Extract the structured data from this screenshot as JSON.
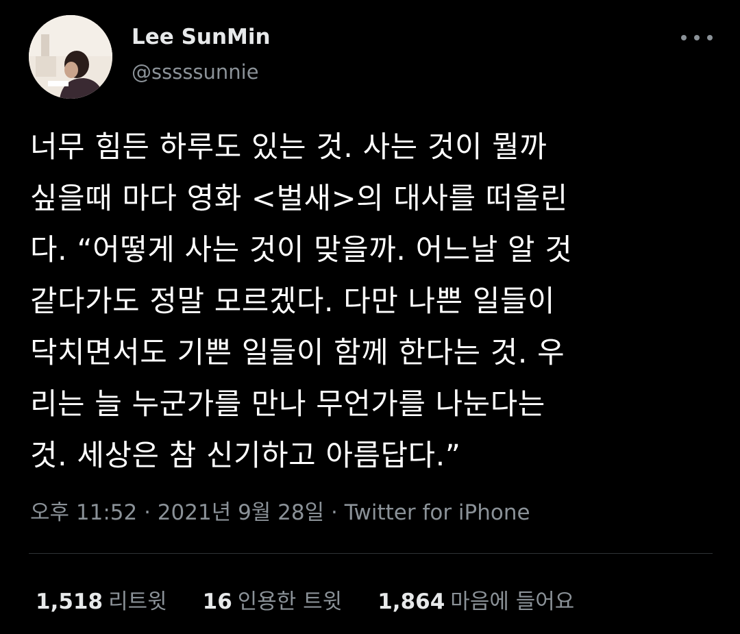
{
  "author": {
    "display_name": "Lee SunMin",
    "handle": "@sssssunnie"
  },
  "tweet": {
    "text": "너무 힘든 하루도 있는 것. 사는 것이 뭘까\n싶을때 마다 영화 <벌새>의 대사를 떠올린\n다. “어떻게 사는 것이 맞을까. 어느날 알 것\n같다가도 정말 모르겠다. 다만 나쁜 일들이\n닥치면서도 기쁜 일들이 함께 한다는 것. 우\n리는 늘 누군가를 만나 무언가를 나눈다는\n것. 세상은 참 신기하고 아름답다.”",
    "time": "오후 11:52",
    "date": "2021년 9월 28일",
    "separator": " · ",
    "source": "Twitter for iPhone"
  },
  "stats": {
    "retweets": {
      "count": "1,518",
      "label": "리트윗"
    },
    "quotes": {
      "count": "16",
      "label": "인용한 트윗"
    },
    "likes": {
      "count": "1,864",
      "label": "마음에 들어요"
    }
  },
  "icons": {
    "more": "more-horizontal-icon",
    "avatar": "profile-avatar"
  },
  "colors": {
    "background": "#000000",
    "primary_text": "#e7e9ea",
    "secondary_text": "#8b9298",
    "divider": "#2f3336"
  }
}
